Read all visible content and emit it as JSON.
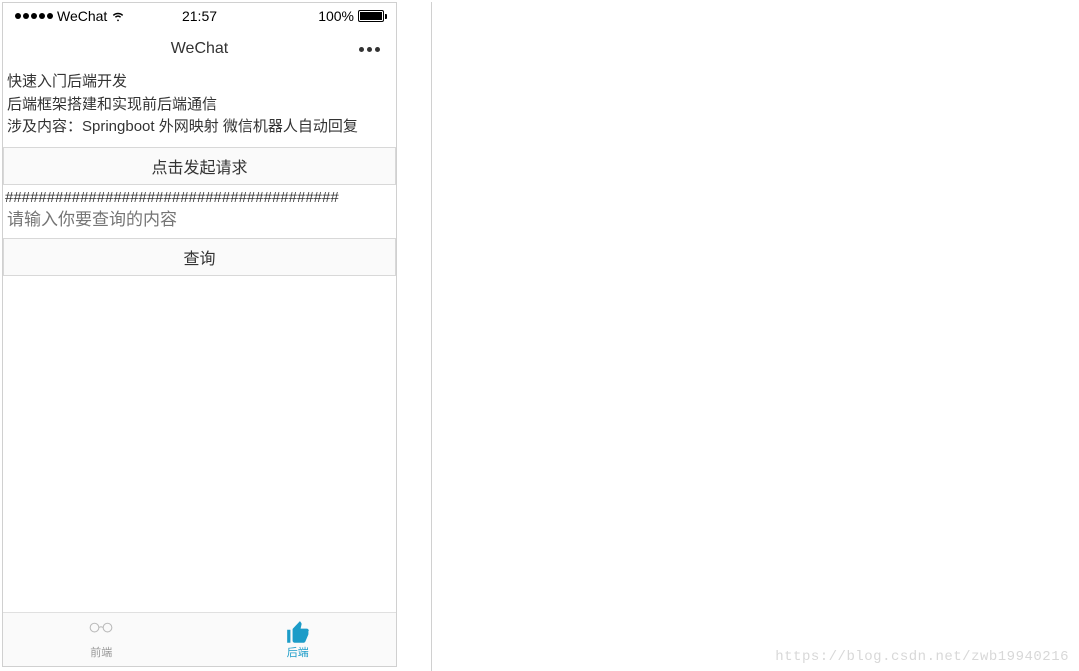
{
  "status_bar": {
    "carrier": "WeChat",
    "time": "21:57",
    "battery_text": "100%"
  },
  "nav": {
    "title": "WeChat"
  },
  "content": {
    "line1": "快速入门后端开发",
    "line2": "后端框架搭建和实现前后端通信",
    "line3": "涉及内容：Springboot 外网映射 微信机器人自动回复"
  },
  "buttons": {
    "request": "点击发起请求",
    "search": "查询"
  },
  "divider": "########################################",
  "input": {
    "placeholder": "请输入你要查询的内容"
  },
  "tabs": {
    "frontend": "前端",
    "backend": "后端"
  },
  "watermark": "https://blog.csdn.net/zwb19940216"
}
